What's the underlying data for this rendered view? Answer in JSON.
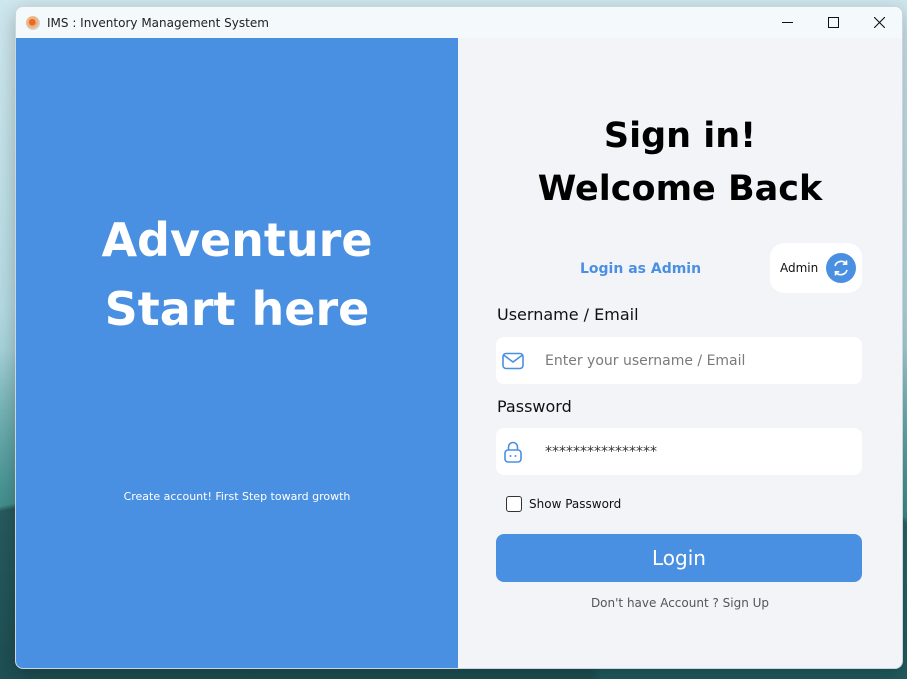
{
  "window": {
    "title": "IMS : Inventory Management System",
    "controls": {
      "minimize": "—",
      "maximize": "☐",
      "close": "✕"
    }
  },
  "left_panel": {
    "headline_line1": "Adventure",
    "headline_line2": "Start here",
    "footer_text": "Create account! First Step toward growth",
    "background_color": "#4a90e2"
  },
  "form": {
    "heading_line1": "Sign in!",
    "heading_line2": "Welcome Back",
    "admin_link": "Login as Admin",
    "admin_toggle_label": "Admin",
    "username_label": "Username / Email",
    "username_placeholder": "Enter your username / Email",
    "password_label": "Password",
    "password_value": "****************",
    "show_password_label": "Show Password",
    "show_password_checked": false,
    "login_button": "Login",
    "signup_text": "Don't have Account ? Sign Up",
    "accent_color": "#4a90e2"
  },
  "icons": {
    "mail": "mail-icon",
    "lock": "lock-icon",
    "refresh": "refresh-icon"
  }
}
